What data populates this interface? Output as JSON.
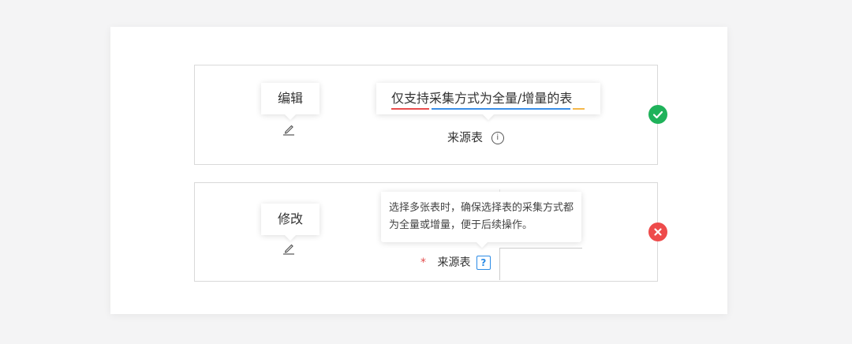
{
  "examples": [
    {
      "status": "correct",
      "edit_tooltip": "编辑",
      "restriction_tooltip": "仅支持采集方式为全量/增量的表",
      "field_label": "来源表",
      "underline_colors": [
        "#e84d4d",
        "#3a8ee6",
        "#f5b74a"
      ]
    },
    {
      "status": "incorrect",
      "edit_tooltip": "修改",
      "help_tooltip": "选择多张表时，确保选择表的采集方式都为全量或增量，便于后续操作。",
      "required_mark": "*",
      "field_label": "来源表",
      "help_icon_glyph": "?"
    }
  ],
  "icons": {
    "edit": "pencil-icon",
    "info": "info-circle-icon",
    "help": "question-square-icon",
    "ok": "check-circle-icon",
    "bad": "close-circle-icon"
  },
  "colors": {
    "ok": "#1fb25a",
    "bad": "#ee4b4b",
    "accent": "#2b8be6"
  }
}
